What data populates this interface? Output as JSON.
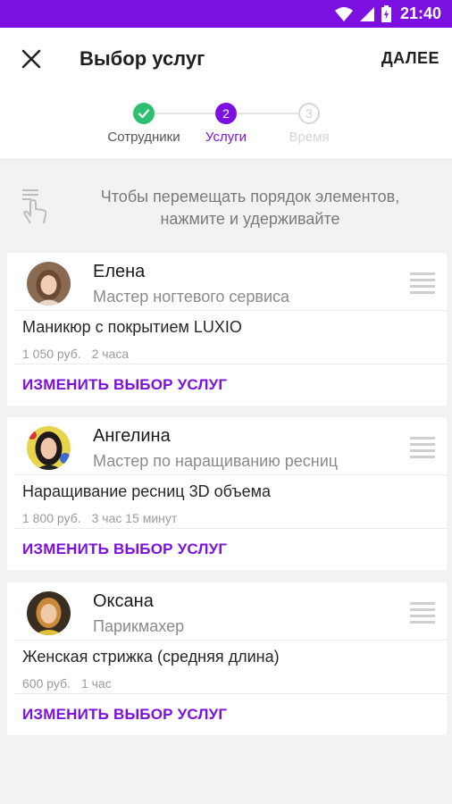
{
  "status_bar": {
    "time": "21:40",
    "accent": "#7b10e0"
  },
  "header": {
    "title": "Выбор услуг",
    "next_label": "ДАЛЕЕ"
  },
  "stepper": {
    "steps": [
      {
        "number": "1",
        "label": "Сотрудники",
        "state": "done"
      },
      {
        "number": "2",
        "label": "Услуги",
        "state": "active"
      },
      {
        "number": "3",
        "label": "Время",
        "state": "inactive"
      }
    ]
  },
  "hint": {
    "line1": "Чтобы перемещать порядок элементов,",
    "line2": "нажмите и удерживайте",
    "icon": "touch-hold-icon"
  },
  "cards": [
    {
      "name": "Елена",
      "role": "Мастер ногтевого сервиса",
      "service": "Маникюр с покрытием LUXIO",
      "price": "1 050 руб.",
      "duration": "2 часа",
      "change_label": "ИЗМЕНИТЬ ВЫБОР УСЛУГ"
    },
    {
      "name": "Ангелина",
      "role": "Мастер по наращиванию ресниц",
      "service": "Наращивание ресниц 3D объема",
      "price": "1 800 руб.",
      "duration": "3 час 15 минут",
      "change_label": "ИЗМЕНИТЬ ВЫБОР УСЛУГ"
    },
    {
      "name": "Оксана",
      "role": "Парикмахер",
      "service": "Женская стрижка (средняя длина)",
      "price": "600 руб.",
      "duration": "1 час",
      "change_label": "ИЗМЕНИТЬ ВЫБОР УСЛУГ"
    }
  ],
  "colors": {
    "accent": "#7b10e0",
    "done": "#2fbf71",
    "inactive": "#d6d6d6"
  }
}
